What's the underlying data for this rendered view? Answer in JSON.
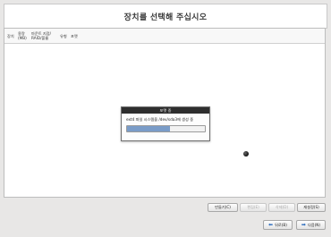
{
  "header": {
    "title": "장치를 선택해 주십시오"
  },
  "table": {
    "columns": [
      "장치",
      "용량\n(MB)",
      "마운트 지점/\nRAID/볼륨",
      "유형",
      "포맷"
    ]
  },
  "dialog": {
    "title": "포맷 중",
    "message": "ext4 파일 시스템을 /dev/sda3에 생성 중",
    "progress": 0.55
  },
  "actions": {
    "create": "만들기(C)",
    "edit": "편집(E)",
    "delete": "삭제(D)",
    "reset": "재설정(S)"
  },
  "nav": {
    "back": "뒤로(B)",
    "next": "다음(N)"
  }
}
